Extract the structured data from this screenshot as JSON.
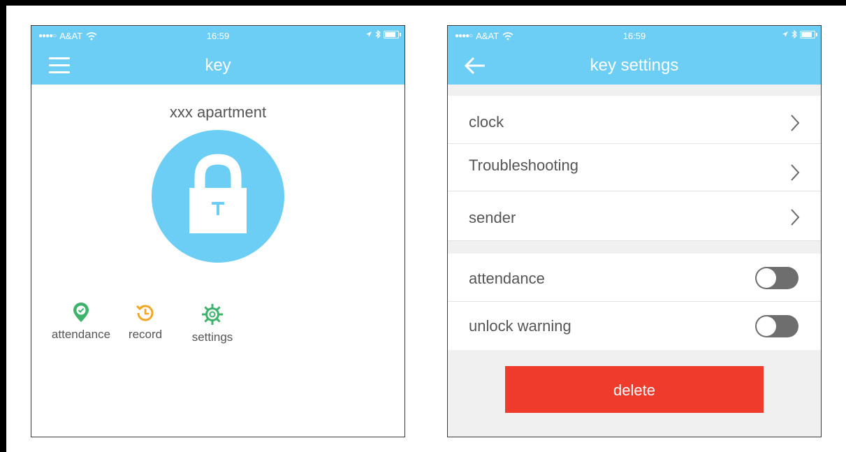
{
  "status_bar": {
    "carrier": "A&AT",
    "time": "16:59"
  },
  "key_screen": {
    "title": "key",
    "apartment_name": "xxx apartment",
    "actions": [
      {
        "label": "attendance",
        "icon": "location-check-icon",
        "color": "#3db36b"
      },
      {
        "label": "record",
        "icon": "history-clock-icon",
        "color": "#f5a623"
      },
      {
        "label": "settings",
        "icon": "gear-icon",
        "color": "#3db36b"
      }
    ],
    "lock_color": "#6dcef5"
  },
  "settings_screen": {
    "title": "key settings",
    "nav_rows": [
      {
        "label": "clock"
      },
      {
        "label": "Troubleshooting"
      },
      {
        "label": "sender"
      }
    ],
    "toggle_rows": [
      {
        "label": "attendance",
        "on": false
      },
      {
        "label": "unlock warning",
        "on": false
      }
    ],
    "delete_label": "delete",
    "delete_color": "#ee3b2b"
  },
  "colors": {
    "header": "#6dcef5",
    "background": "#f0f0f0"
  }
}
